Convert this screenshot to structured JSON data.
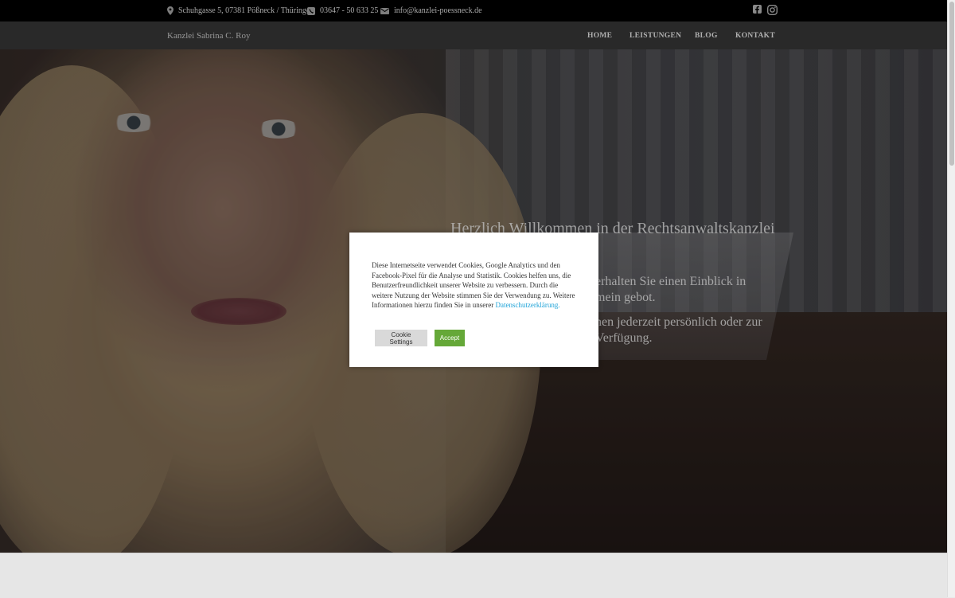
{
  "topbar": {
    "address": "Schuhgasse 5, 07381 Pößneck / Thüringen",
    "phone": "03647 - 50 633 25",
    "email": "info@kanzlei-poessneck.de",
    "icons": [
      "map-pin-icon",
      "phone-icon",
      "envelope-icon",
      "facebook-icon",
      "instagram-icon"
    ]
  },
  "nav": {
    "brand": "Kanzlei Sabrina C. Roy",
    "items": [
      "HOME",
      "LEISTUNGEN",
      "BLOG",
      "KONTAKT"
    ]
  },
  "hero": {
    "title": "Herzlich Willkommen in der Rechtsanwaltskanzlei",
    "p1": "erhalten Sie einen Einblick in mein gebot.",
    "p2": "nen jederzeit persönlich oder zur Verfügung."
  },
  "cookie": {
    "message": "Diese Internetseite verwendet Cookies, Google Analytics und den Facebook-Pixel für die Analyse und Statistik. Cookies helfen uns, die Benutzerfreundlichkeit unserer Website zu verbessern. Durch die weitere Nutzung der Website stimmen Sie der Verwendung zu. Weitere Informationen hierzu finden Sie in unserer",
    "link": "Datenschutzerklärung.",
    "settings_label": "Cookie Settings",
    "accept_label": "Accept"
  },
  "colors": {
    "accept_green": "#65a838",
    "link_blue": "#1fa3d8",
    "topbar_bg": "#000000"
  }
}
